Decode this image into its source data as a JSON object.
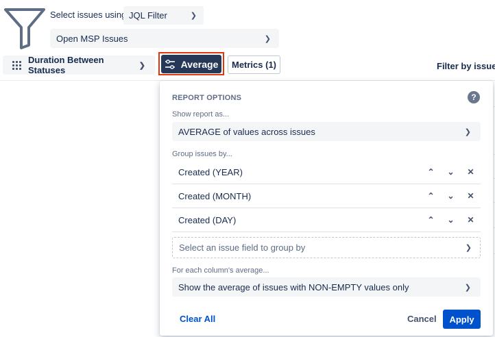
{
  "filter": {
    "select_label": "Select issues using",
    "type_value": "JQL Filter",
    "filter_value": "Open MSP Issues"
  },
  "toolbar": {
    "report_type": "Duration Between Statuses",
    "average_label": "Average",
    "metrics_label": "Metrics (1)",
    "filter_by_label": "Filter by issue c"
  },
  "panel": {
    "title": "REPORT OPTIONS",
    "help": "?",
    "show_report_label": "Show report as...",
    "show_report_value": "AVERAGE of values across issues",
    "group_label": "Group issues by...",
    "groups": [
      {
        "label": "Created (YEAR)"
      },
      {
        "label": "Created (MONTH)"
      },
      {
        "label": "Created (DAY)"
      }
    ],
    "group_placeholder": "Select an issue field to group by",
    "each_column_label": "For each column's average...",
    "each_column_value": "Show the average of issues with NON-EMPTY values only",
    "clear_label": "Clear All",
    "cancel_label": "Cancel",
    "apply_label": "Apply"
  },
  "icons": {
    "move_up": "up-chevrons-icon",
    "move_down": "down-chevrons-icon",
    "remove": "close-icon"
  },
  "colors": {
    "accent": "#0052cc",
    "active_button": "#253858",
    "highlight_outline": "#de350b"
  }
}
